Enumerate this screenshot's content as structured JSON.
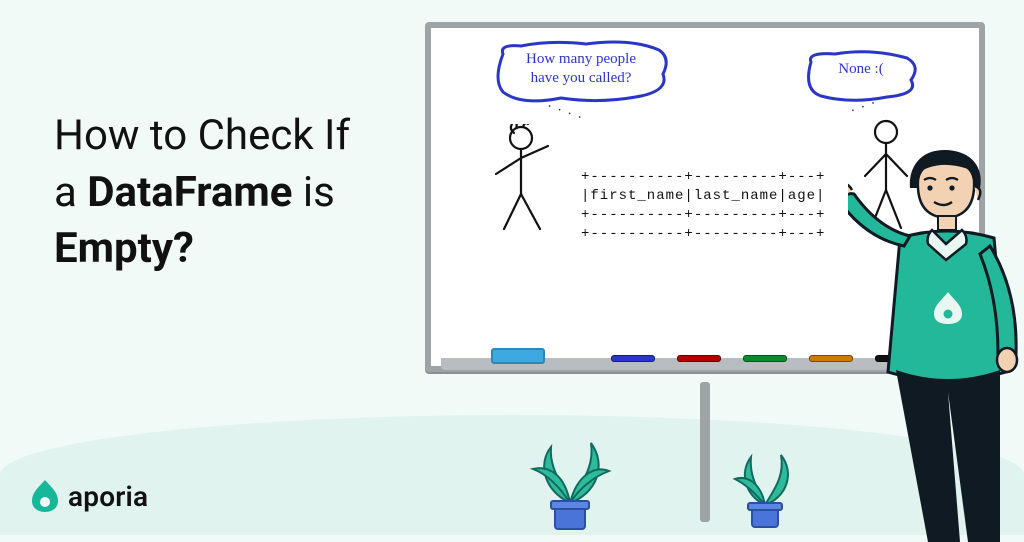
{
  "headline": {
    "line1": "How to Check If",
    "line2_prefix": "a ",
    "line2_bold": "DataFrame",
    "line2_suffix": " is",
    "line3_bold": "Empty?"
  },
  "brand": {
    "name": "aporia"
  },
  "whiteboard": {
    "bubble_left": "How many people\nhave you called?",
    "bubble_right": "None :(",
    "dataframe_ascii": "+----------+---------+---+\n|first_name|last_name|age|\n+----------+---------+---+\n+----------+---------+---+",
    "marker_colors": [
      "#2b36c9",
      "#b30000",
      "#0a8a2f",
      "#cc7a00",
      "#111111"
    ]
  },
  "colors": {
    "brand_green": "#17b79a",
    "bubble_blue": "#2b36c9"
  }
}
